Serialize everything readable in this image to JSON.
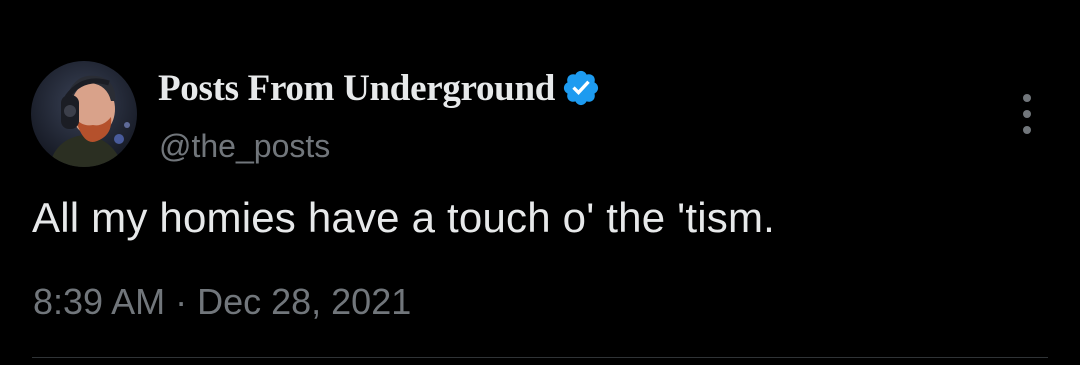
{
  "tweet": {
    "author": {
      "display_name": "Posts From Underground",
      "handle": "@the_posts",
      "verified": true,
      "avatar_icon": "avatar-photo",
      "verified_icon": "verified-badge-icon"
    },
    "text": "All my homies have a touch o' the 'tism.",
    "time": "8:39 AM",
    "separator": "·",
    "date": "Dec 28, 2021",
    "more_icon": "more-options-icon"
  },
  "colors": {
    "background": "#000000",
    "primary_text": "#e7e9ea",
    "secondary_text": "#71767b",
    "verified_badge": "#1d9bf0",
    "divider": "#2f3336"
  }
}
